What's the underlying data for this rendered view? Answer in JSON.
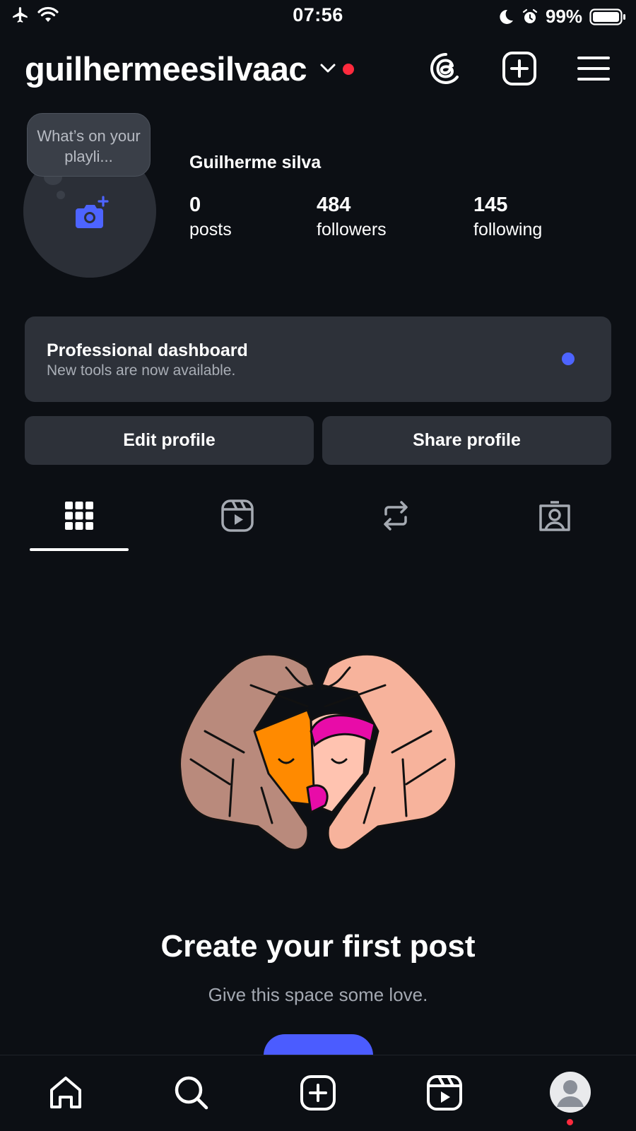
{
  "status_bar": {
    "time": "07:56",
    "battery": "99%"
  },
  "header": {
    "username": "guilhermeesilvaac"
  },
  "profile": {
    "note": "What’s on your playli...",
    "display_name": "Guilherme silva",
    "stats": {
      "posts": {
        "count": "0",
        "label": "posts"
      },
      "followers": {
        "count": "484",
        "label": "followers"
      },
      "following": {
        "count": "145",
        "label": "following"
      }
    }
  },
  "dashboard": {
    "title": "Professional dashboard",
    "subtitle": "New tools are now available."
  },
  "actions": {
    "edit_label": "Edit profile",
    "share_label": "Share profile"
  },
  "tabs": [
    "grid-icon",
    "reels-icon",
    "reposts-icon",
    "tagged-icon"
  ],
  "empty_state": {
    "title": "Create your first post",
    "subtitle": "Give this space some love."
  },
  "bottom_nav": [
    "home-icon",
    "search-icon",
    "create-icon",
    "reels-icon",
    "profile-avatar"
  ],
  "colors": {
    "background": "#0c0f14",
    "card": "#2d3139",
    "accent": "#4b5cff",
    "notification": "#ff2a3d"
  }
}
